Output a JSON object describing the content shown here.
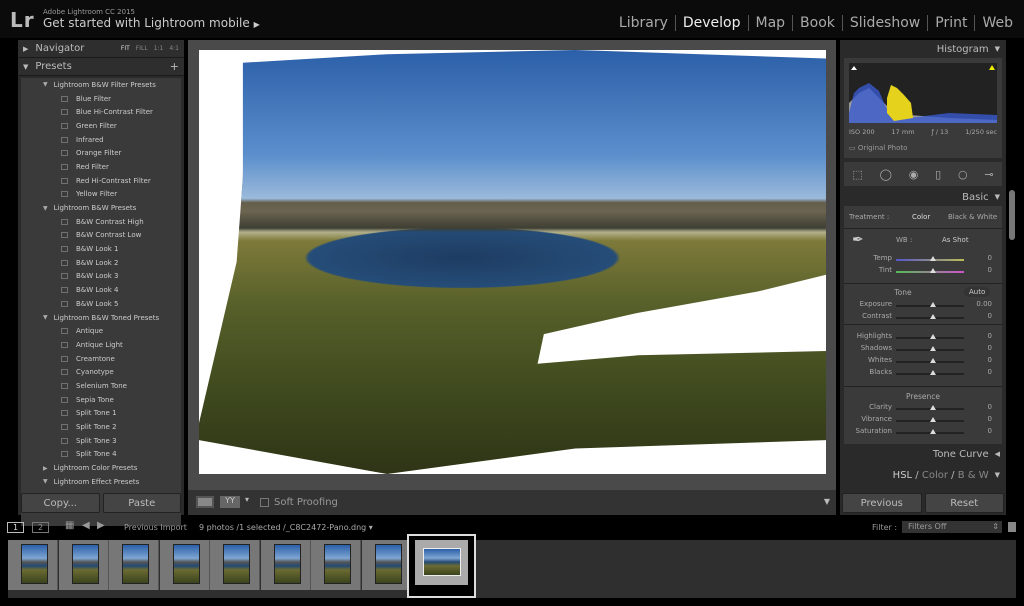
{
  "app": {
    "logo": "Lr",
    "title": "Adobe Lightroom CC 2015",
    "mobile": "Get started with Lightroom mobile"
  },
  "modules": [
    {
      "label": "Library"
    },
    {
      "label": "Develop",
      "active": true
    },
    {
      "label": "Map"
    },
    {
      "label": "Book"
    },
    {
      "label": "Slideshow"
    },
    {
      "label": "Print"
    },
    {
      "label": "Web"
    }
  ],
  "navigator": {
    "title": "Navigator",
    "options": [
      "FIT",
      "FILL",
      "1:1",
      "4:1"
    ]
  },
  "presets": {
    "title": "Presets",
    "items": [
      {
        "t": "f",
        "label": "Lightroom B&W Filter Presets",
        "open": true
      },
      {
        "t": "p",
        "label": "Blue Filter"
      },
      {
        "t": "p",
        "label": "Blue Hi-Contrast Filter"
      },
      {
        "t": "p",
        "label": "Green Filter"
      },
      {
        "t": "p",
        "label": "Infrared"
      },
      {
        "t": "p",
        "label": "Orange Filter"
      },
      {
        "t": "p",
        "label": "Red Filter"
      },
      {
        "t": "p",
        "label": "Red Hi-Contrast Filter"
      },
      {
        "t": "p",
        "label": "Yellow Filter"
      },
      {
        "t": "f",
        "label": "Lightroom B&W Presets",
        "open": true
      },
      {
        "t": "p",
        "label": "B&W Contrast High"
      },
      {
        "t": "p",
        "label": "B&W Contrast Low"
      },
      {
        "t": "p",
        "label": "B&W Look 1"
      },
      {
        "t": "p",
        "label": "B&W Look 2"
      },
      {
        "t": "p",
        "label": "B&W Look 3"
      },
      {
        "t": "p",
        "label": "B&W Look 4"
      },
      {
        "t": "p",
        "label": "B&W Look 5"
      },
      {
        "t": "f",
        "label": "Lightroom B&W Toned Presets",
        "open": true
      },
      {
        "t": "p",
        "label": "Antique"
      },
      {
        "t": "p",
        "label": "Antique Light"
      },
      {
        "t": "p",
        "label": "Creamtone"
      },
      {
        "t": "p",
        "label": "Cyanotype"
      },
      {
        "t": "p",
        "label": "Selenium Tone"
      },
      {
        "t": "p",
        "label": "Sepia Tone"
      },
      {
        "t": "p",
        "label": "Split Tone 1"
      },
      {
        "t": "p",
        "label": "Split Tone 2"
      },
      {
        "t": "p",
        "label": "Split Tone 3"
      },
      {
        "t": "p",
        "label": "Split Tone 4"
      },
      {
        "t": "f",
        "label": "Lightroom Color Presets",
        "open": false
      },
      {
        "t": "f",
        "label": "Lightroom Effect Presets",
        "open": true
      }
    ]
  },
  "left_buttons": {
    "copy": "Copy...",
    "paste": "Paste"
  },
  "toolbar": {
    "soft_proofing": "Soft Proofing",
    "soft_proofing_checked": false
  },
  "histogram": {
    "title": "Histogram",
    "iso": "ISO 200",
    "focal": "17 mm",
    "aperture": "ƒ / 13",
    "shutter": "1/250 sec",
    "original_photo": "Original Photo"
  },
  "basic": {
    "title": "Basic",
    "treatment_label": "Treatment :",
    "treatment_color": "Color",
    "treatment_bw": "Black & White",
    "wb_label": "WB :",
    "wb_value": "As Shot",
    "tone_label": "Tone",
    "auto": "Auto",
    "presence_label": "Presence",
    "sliders": [
      {
        "label": "Temp",
        "value": "0"
      },
      {
        "label": "Tint",
        "value": "0"
      },
      {
        "label": "Exposure",
        "value": "0.00"
      },
      {
        "label": "Contrast",
        "value": "0"
      },
      {
        "label": "Highlights",
        "value": "0"
      },
      {
        "label": "Shadows",
        "value": "0"
      },
      {
        "label": "Whites",
        "value": "0"
      },
      {
        "label": "Blacks",
        "value": "0"
      },
      {
        "label": "Clarity",
        "value": "0"
      },
      {
        "label": "Vibrance",
        "value": "0"
      },
      {
        "label": "Saturation",
        "value": "0"
      }
    ]
  },
  "tone_curve": "Tone Curve",
  "hsl": {
    "hsl": "HSL",
    "color": "Color",
    "bw": "B & W"
  },
  "right_buttons": {
    "previous": "Previous",
    "reset": "Reset"
  },
  "filmstrip": {
    "page1": "1",
    "page2": "2",
    "source": "Previous Import",
    "info": "9 photos /1 selected /_C8C2472-Pano.dng",
    "filter_label": "Filter :",
    "filter_value": "Filters Off",
    "photo_count": 9,
    "selected_index": 9
  }
}
